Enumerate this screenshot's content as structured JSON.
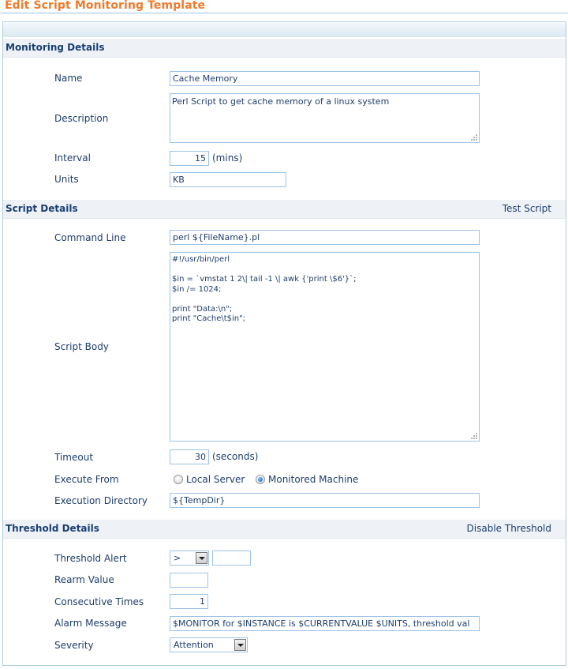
{
  "page": {
    "title": "Edit Script Monitoring Template"
  },
  "monitoring": {
    "heading": "Monitoring Details",
    "name_label": "Name",
    "name_value": "Cache Memory",
    "description_label": "Description",
    "description_value": "Perl Script to get cache memory of a linux system",
    "interval_label": "Interval",
    "interval_value": "15",
    "interval_suffix": "(mins)",
    "units_label": "Units",
    "units_value": "KB"
  },
  "script": {
    "heading": "Script Details",
    "test_link": "Test Script",
    "command_label": "Command Line",
    "command_value": "perl ${FileName}.pl",
    "body_label": "Script Body",
    "body_value": "#!/usr/bin/perl\n\n$in = `vmstat 1 2\\| tail -1 \\| awk {'print \\$6'}`;\n$in /= 1024;\n\nprint \"Data:\\n\";\nprint \"Cache\\t$in\";",
    "timeout_label": "Timeout",
    "timeout_value": "30",
    "timeout_suffix": "(seconds)",
    "execute_from_label": "Execute From",
    "execute_options": [
      {
        "label": "Local Server",
        "selected": false
      },
      {
        "label": "Monitored Machine",
        "selected": true
      }
    ],
    "exec_dir_label": "Execution Directory",
    "exec_dir_value": "${TempDir}"
  },
  "threshold": {
    "heading": "Threshold Details",
    "disable_link": "Disable Threshold",
    "alert_label": "Threshold Alert",
    "alert_operator": ">",
    "alert_value": "",
    "rearm_label": "Rearm Value",
    "rearm_value": "",
    "consecutive_label": "Consecutive Times",
    "consecutive_value": "1",
    "alarm_label": "Alarm Message",
    "alarm_value": "$MONITOR for $INSTANCE is $CURRENTVALUE $UNITS, threshold val",
    "severity_label": "Severity",
    "severity_value": "Attention"
  }
}
